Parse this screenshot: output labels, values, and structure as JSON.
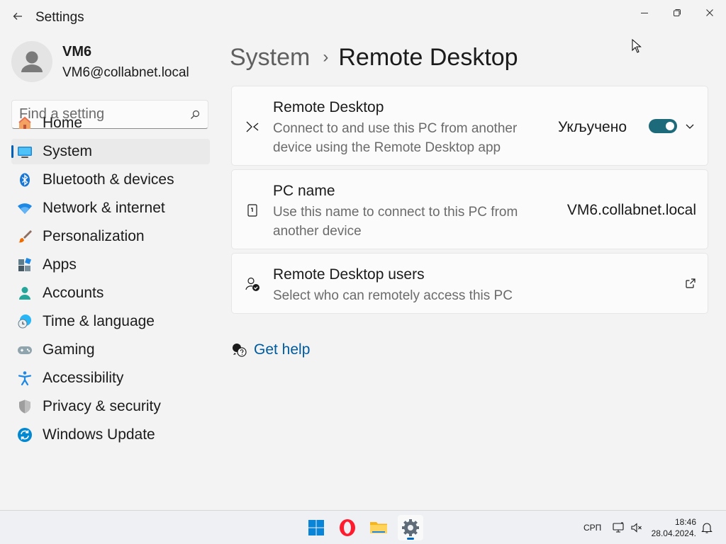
{
  "window": {
    "title": "Settings"
  },
  "user": {
    "name": "VM6",
    "email": "VM6@collabnet.local"
  },
  "search": {
    "placeholder": "Find a setting"
  },
  "nav": {
    "items": [
      {
        "label": "Home",
        "icon": "home-icon"
      },
      {
        "label": "System",
        "icon": "system-icon",
        "selected": true
      },
      {
        "label": "Bluetooth & devices",
        "icon": "bluetooth-icon"
      },
      {
        "label": "Network & internet",
        "icon": "wifi-icon"
      },
      {
        "label": "Personalization",
        "icon": "brush-icon"
      },
      {
        "label": "Apps",
        "icon": "apps-icon"
      },
      {
        "label": "Accounts",
        "icon": "accounts-icon"
      },
      {
        "label": "Time & language",
        "icon": "time-language-icon"
      },
      {
        "label": "Gaming",
        "icon": "gamepad-icon"
      },
      {
        "label": "Accessibility",
        "icon": "accessibility-icon"
      },
      {
        "label": "Privacy & security",
        "icon": "shield-icon"
      },
      {
        "label": "Windows Update",
        "icon": "update-icon"
      }
    ]
  },
  "breadcrumb": {
    "parent": "System",
    "separator": "›",
    "current": "Remote Desktop"
  },
  "cards": {
    "remote_desktop": {
      "title": "Remote Desktop",
      "description": "Connect to and use this PC from another device using the Remote Desktop app",
      "toggle_status": "Укључено",
      "toggle_on": true
    },
    "pc_name": {
      "title": "PC name",
      "description": "Use this name to connect to this PC from another device",
      "value": "VM6.collabnet.local"
    },
    "users": {
      "title": "Remote Desktop users",
      "description": "Select who can remotely access this PC"
    }
  },
  "help": {
    "label": "Get help"
  },
  "taskbar": {
    "language": "СРП",
    "time": "18:46",
    "date": "28.04.2024.",
    "accent_color": "#0067c0"
  }
}
